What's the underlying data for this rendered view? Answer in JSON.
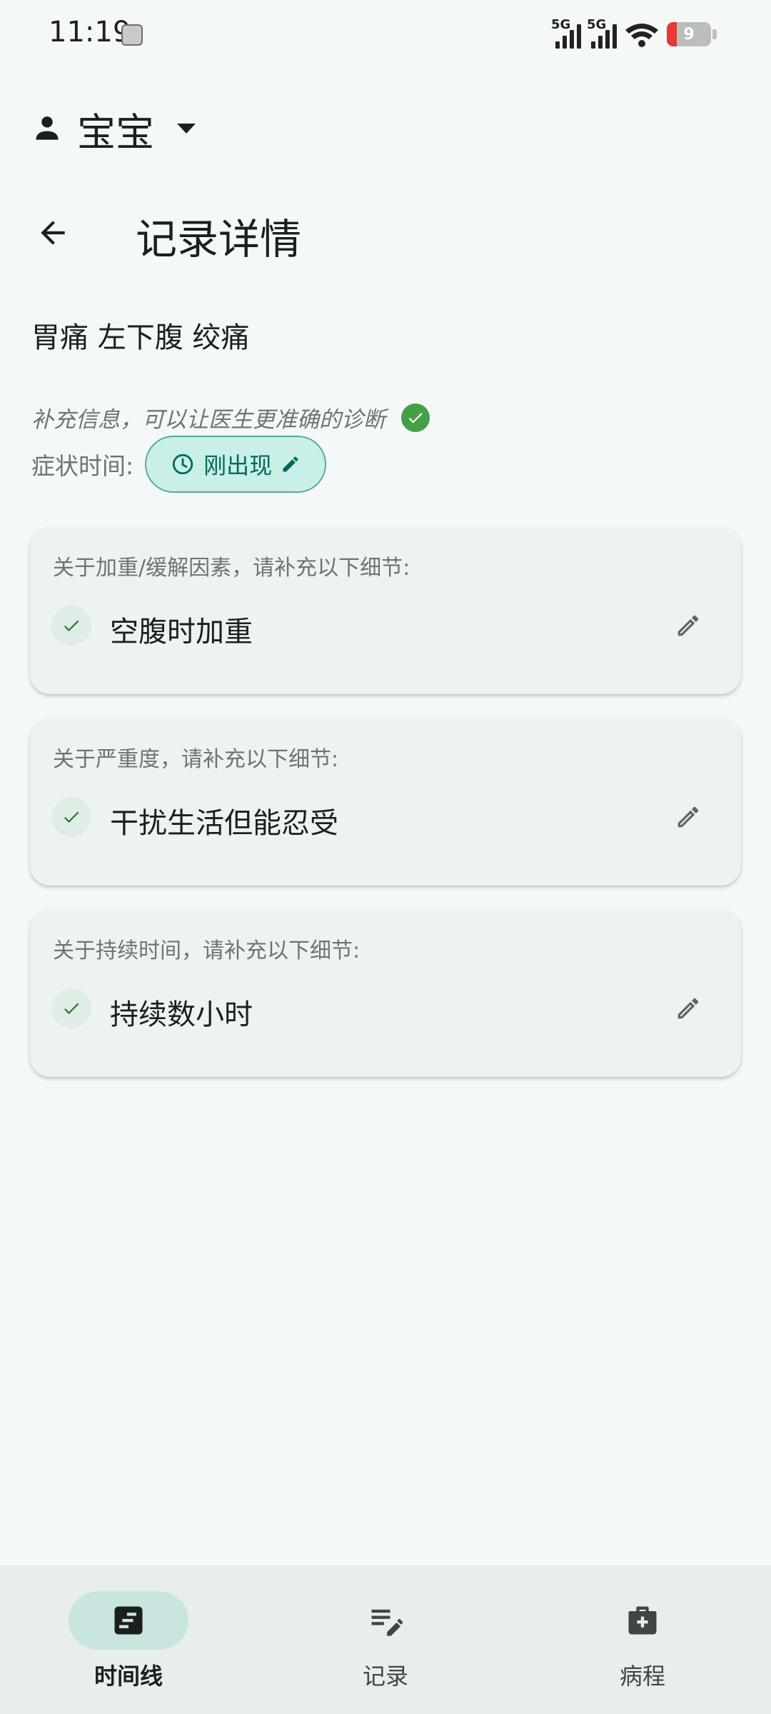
{
  "status_bar": {
    "time": "11:19",
    "network_1": "5G",
    "network_2": "5G",
    "battery": "9"
  },
  "profile": {
    "name": "宝宝",
    "icon": "person-icon"
  },
  "appbar": {
    "title": "记录详情"
  },
  "symptom": {
    "title": "胃痛 左下腹 绞痛",
    "hint": "补充信息，可以让医生更准确的诊断",
    "time_label": "症状时间:",
    "time_value": "刚出现"
  },
  "cards": [
    {
      "question": "关于加重/缓解因素，请补充以下细节:",
      "answer": "空腹时加重"
    },
    {
      "question": "关于严重度，请补充以下细节:",
      "answer": "干扰生活但能忍受"
    },
    {
      "question": "关于持续时间，请补充以下细节:",
      "answer": "持续数小时"
    }
  ],
  "bottom_nav": [
    {
      "label": "时间线",
      "icon": "timeline-icon",
      "active": true
    },
    {
      "label": "记录",
      "icon": "edit-note-icon",
      "active": false
    },
    {
      "label": "病程",
      "icon": "medical-bag-icon",
      "active": false
    }
  ],
  "colors": {
    "background": "#f4f9f7",
    "accent": "#00695c",
    "chip_bg": "#c8efe8",
    "success": "#43a047",
    "nav_active_pill": "#c8e6df"
  }
}
